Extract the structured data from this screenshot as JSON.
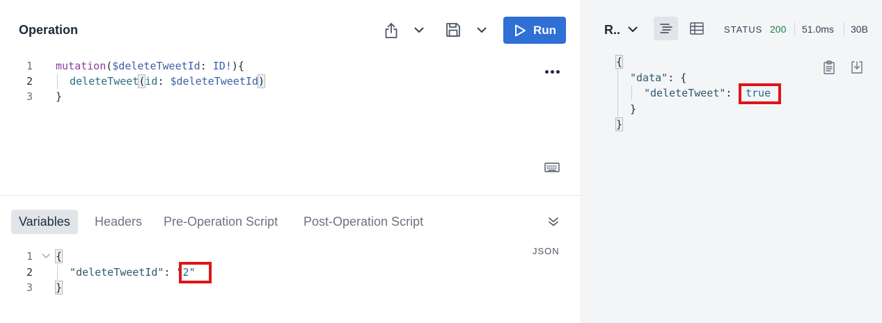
{
  "operation": {
    "title": "Operation",
    "run_label": "Run",
    "code": {
      "line_numbers": [
        "1",
        "2",
        "3"
      ],
      "l1_kw": "mutation",
      "l1_open": "(",
      "l1_var": "$deleteTweetId",
      "l1_colon": ": ",
      "l1_type": "ID!",
      "l1_close": "){",
      "l2_fn": "deleteTweet",
      "l2_open": "(",
      "l2_arg": "id",
      "l2_colon": ": ",
      "l2_var": "$deleteTweetId",
      "l2_close": ")",
      "l3": "}"
    }
  },
  "tabs": [
    "Variables",
    "Headers",
    "Pre-Operation Script",
    "Post-Operation Script"
  ],
  "variables": {
    "format_label": "JSON",
    "line_numbers": [
      "1",
      "2",
      "3"
    ],
    "open": "{",
    "key": "\"deleteTweetId\"",
    "colon": ": ",
    "value": "\"2\"",
    "close": "}"
  },
  "response": {
    "label": "R..",
    "status_label": "STATUS",
    "status_code": "200",
    "time": "51.0ms",
    "size": "30B",
    "json": {
      "open": "{",
      "data_key": "\"data\"",
      "data_colon": ": {",
      "delete_key": "\"deleteTweet\"",
      "delete_colon": ":",
      "value": "true",
      "inner_close": "}",
      "close": "}"
    }
  },
  "colors": {
    "run_button": "#2f6fd6",
    "highlight_box": "#e01515",
    "status_ok": "#1e7d4a"
  }
}
